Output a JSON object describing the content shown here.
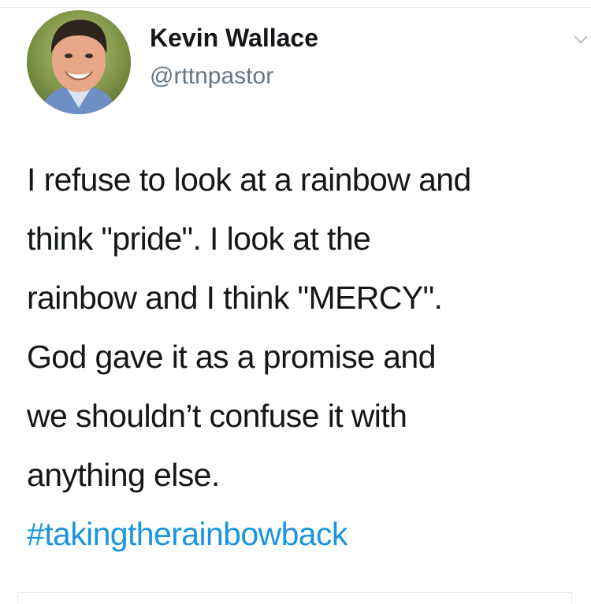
{
  "user": {
    "display_name": "Kevin Wallace",
    "handle": "@rttnpastor"
  },
  "icons": {
    "avatar": "profile-photo",
    "menu": "chevron-down-icon"
  },
  "tweet": {
    "lines": [
      "I refuse to look at a rainbow and",
      "think \"pride\". I look at the",
      "rainbow and I think \"MERCY\".",
      "God gave it as a promise and",
      "we shouldn’t confuse it with",
      "anything else."
    ],
    "hashtag": "#takingtherainbowback"
  },
  "colors": {
    "text": "#14171a",
    "handle": "#657786",
    "hashtag": "#1b95e0"
  }
}
